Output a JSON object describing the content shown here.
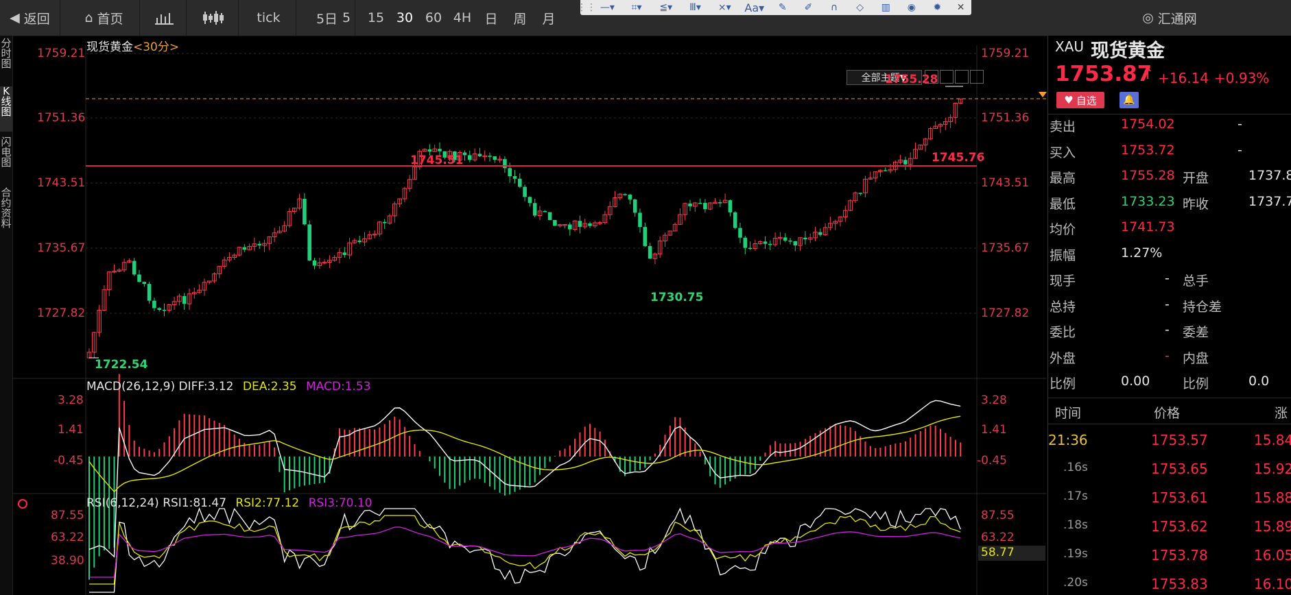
{
  "toolbar": {
    "back": "返回",
    "home": "首页",
    "tick": "tick",
    "five_day": "5日",
    "periods": [
      "5",
      "15",
      "30",
      "60",
      "4H",
      "日",
      "周",
      "月"
    ],
    "brand": "汇通网"
  },
  "draw_tools": [
    "line-tool-icon",
    "rect-tool-icon",
    "text-tool-icon",
    "fib-tool-icon",
    "pattern-tool-icon",
    "Aa",
    "ruler-icon",
    "pen-icon",
    "magnet-icon",
    "eraser-icon",
    "trash-icon",
    "eye-icon",
    "gear-icon",
    "close-icon"
  ],
  "left_rail": [
    "分时图",
    "K线图",
    "闪电图",
    "合约资料"
  ],
  "chart": {
    "title": "现货黄金",
    "period": "<30分>",
    "theme_button": "全部主题▼",
    "price_axis": [
      "1759.21",
      "1751.36",
      "1743.51",
      "1735.67",
      "1727.82"
    ],
    "high_label": "1755.28",
    "low_label": "1722.54",
    "mark_1745_51": "1745.51",
    "mark_1745_76": "1745.76",
    "mark_1730_75": "1730.75",
    "macd": {
      "name": "MACD(26,12,9)",
      "diff": "DIFF:3.12",
      "dea": "DEA:2.35",
      "macd": "MACD:1.53",
      "axis": [
        "3.28",
        "1.41",
        "-0.45"
      ]
    },
    "rsi": {
      "name": "RSI(6,12,24)",
      "rsi1": "RSI1:81.47",
      "rsi2": "RSI2:77.12",
      "rsi3": "RSI3:70.10",
      "axis": [
        "87.55",
        "63.22",
        "38.90"
      ],
      "current": "58.77"
    },
    "colors": {
      "up": "#ff3b4e",
      "down": "#1fd07a",
      "diff": "#ffffff",
      "dea": "#e6e600",
      "rsi3": "#d020e0"
    }
  },
  "quote": {
    "symbol": "XAU",
    "name": "现货黄金",
    "price": "1753.87",
    "change": "+16.14",
    "change_pct": "+0.93%",
    "watch_btn": "自选",
    "rows": [
      {
        "l1": "卖出",
        "v1": "1754.02",
        "l2": "",
        "v2": "-"
      },
      {
        "l1": "买入",
        "v1": "1753.72",
        "l2": "",
        "v2": "-"
      },
      {
        "l1": "最高",
        "v1": "1755.28",
        "l2": "开盘",
        "v2": "1737.8"
      },
      {
        "l1": "最低",
        "v1": "1733.23",
        "l2": "昨收",
        "v2": "1737.7"
      },
      {
        "l1": "均价",
        "v1": "1741.73",
        "l2": "",
        "v2": ""
      },
      {
        "l1": "振幅",
        "v1": "1.27%",
        "l2": "",
        "v2": ""
      },
      {
        "l1": "现手",
        "v1": "-",
        "l2": "总手",
        "v2": ""
      },
      {
        "l1": "总持",
        "v1": "-",
        "l2": "持仓差",
        "v2": ""
      },
      {
        "l1": "委比",
        "v1": "-",
        "l2": "委差",
        "v2": ""
      },
      {
        "l1": "外盘",
        "v1": "-",
        "l2": "内盘",
        "v2": ""
      },
      {
        "l1": "比例",
        "v1": "0.00",
        "l2": "比例",
        "v2": "0.0"
      }
    ],
    "trades_header": [
      "时间",
      "价格",
      "涨"
    ],
    "trades": [
      {
        "t": "21:36",
        "p": "1753.57",
        "c": "15.84"
      },
      {
        "t": ".16s",
        "p": "1753.65",
        "c": "15.92"
      },
      {
        "t": ".17s",
        "p": "1753.61",
        "c": "15.88"
      },
      {
        "t": ".18s",
        "p": "1753.62",
        "c": "15.89"
      },
      {
        "t": ".19s",
        "p": "1753.78",
        "c": "16.05"
      },
      {
        "t": ".20s",
        "p": "1753.83",
        "c": "16.10"
      }
    ]
  }
}
